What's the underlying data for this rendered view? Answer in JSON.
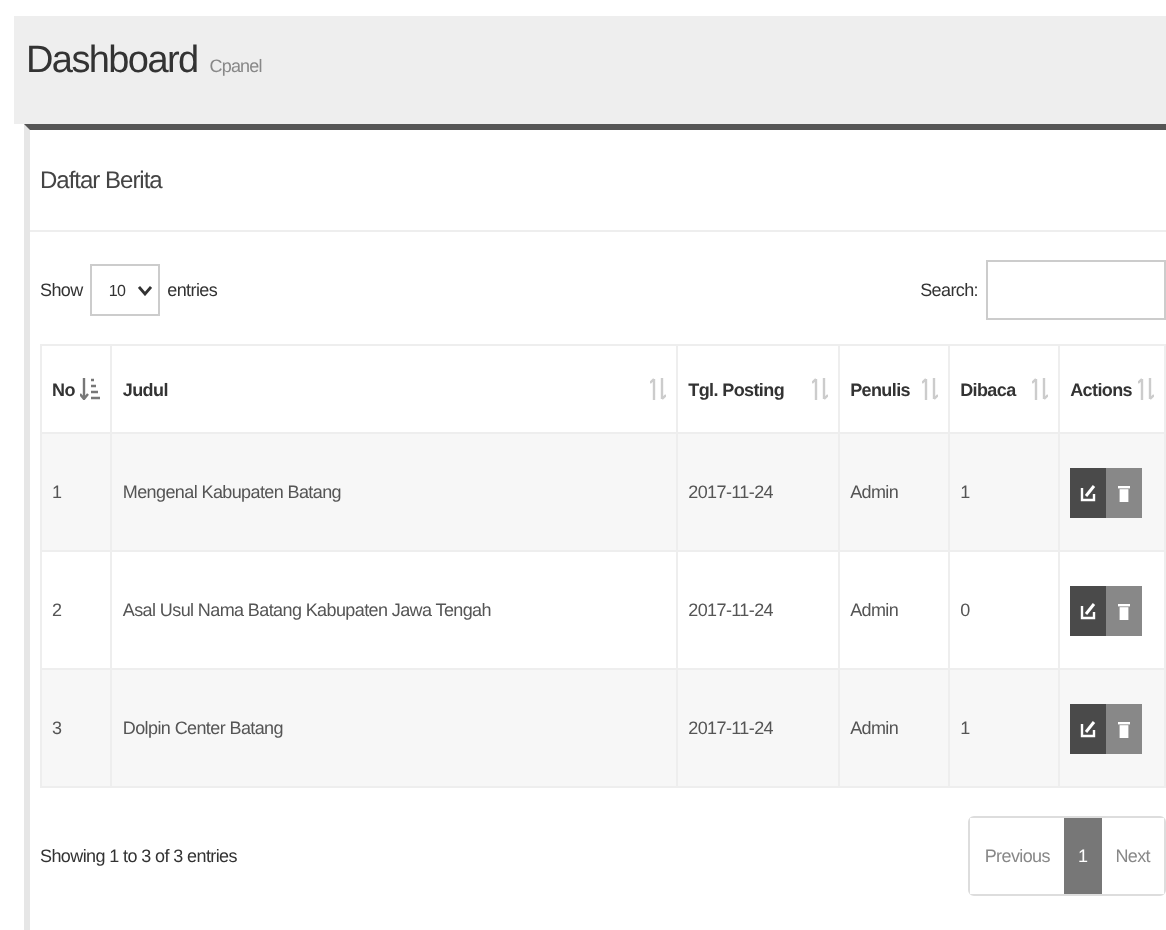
{
  "header": {
    "title": "Dashboard",
    "subtitle": "Cpanel"
  },
  "panel": {
    "title": "Daftar Berita"
  },
  "length_control": {
    "before": "Show",
    "value": "10",
    "after": "entries"
  },
  "search": {
    "label": "Search:"
  },
  "table": {
    "columns": [
      {
        "label": "No",
        "sorted": true
      },
      {
        "label": "Judul",
        "sorted": false
      },
      {
        "label": "Tgl. Posting",
        "sorted": false
      },
      {
        "label": "Penulis",
        "sorted": false
      },
      {
        "label": "Dibaca",
        "sorted": false
      },
      {
        "label": "Actions",
        "sorted": false
      }
    ],
    "rows": [
      {
        "no": "1",
        "judul": "Mengenal Kabupaten Batang",
        "tgl": "2017-11-24",
        "penulis": "Admin",
        "dibaca": "1"
      },
      {
        "no": "2",
        "judul": "Asal Usul Nama Batang Kabupaten Jawa Tengah",
        "tgl": "2017-11-24",
        "penulis": "Admin",
        "dibaca": "0"
      },
      {
        "no": "3",
        "judul": "Dolpin Center Batang",
        "tgl": "2017-11-24",
        "penulis": "Admin",
        "dibaca": "1"
      }
    ]
  },
  "info": "Showing 1 to 3 of 3 entries",
  "pagination": [
    {
      "label": "Previous",
      "selected": false
    },
    {
      "label": "1",
      "selected": true
    },
    {
      "label": "Next",
      "selected": false
    }
  ]
}
